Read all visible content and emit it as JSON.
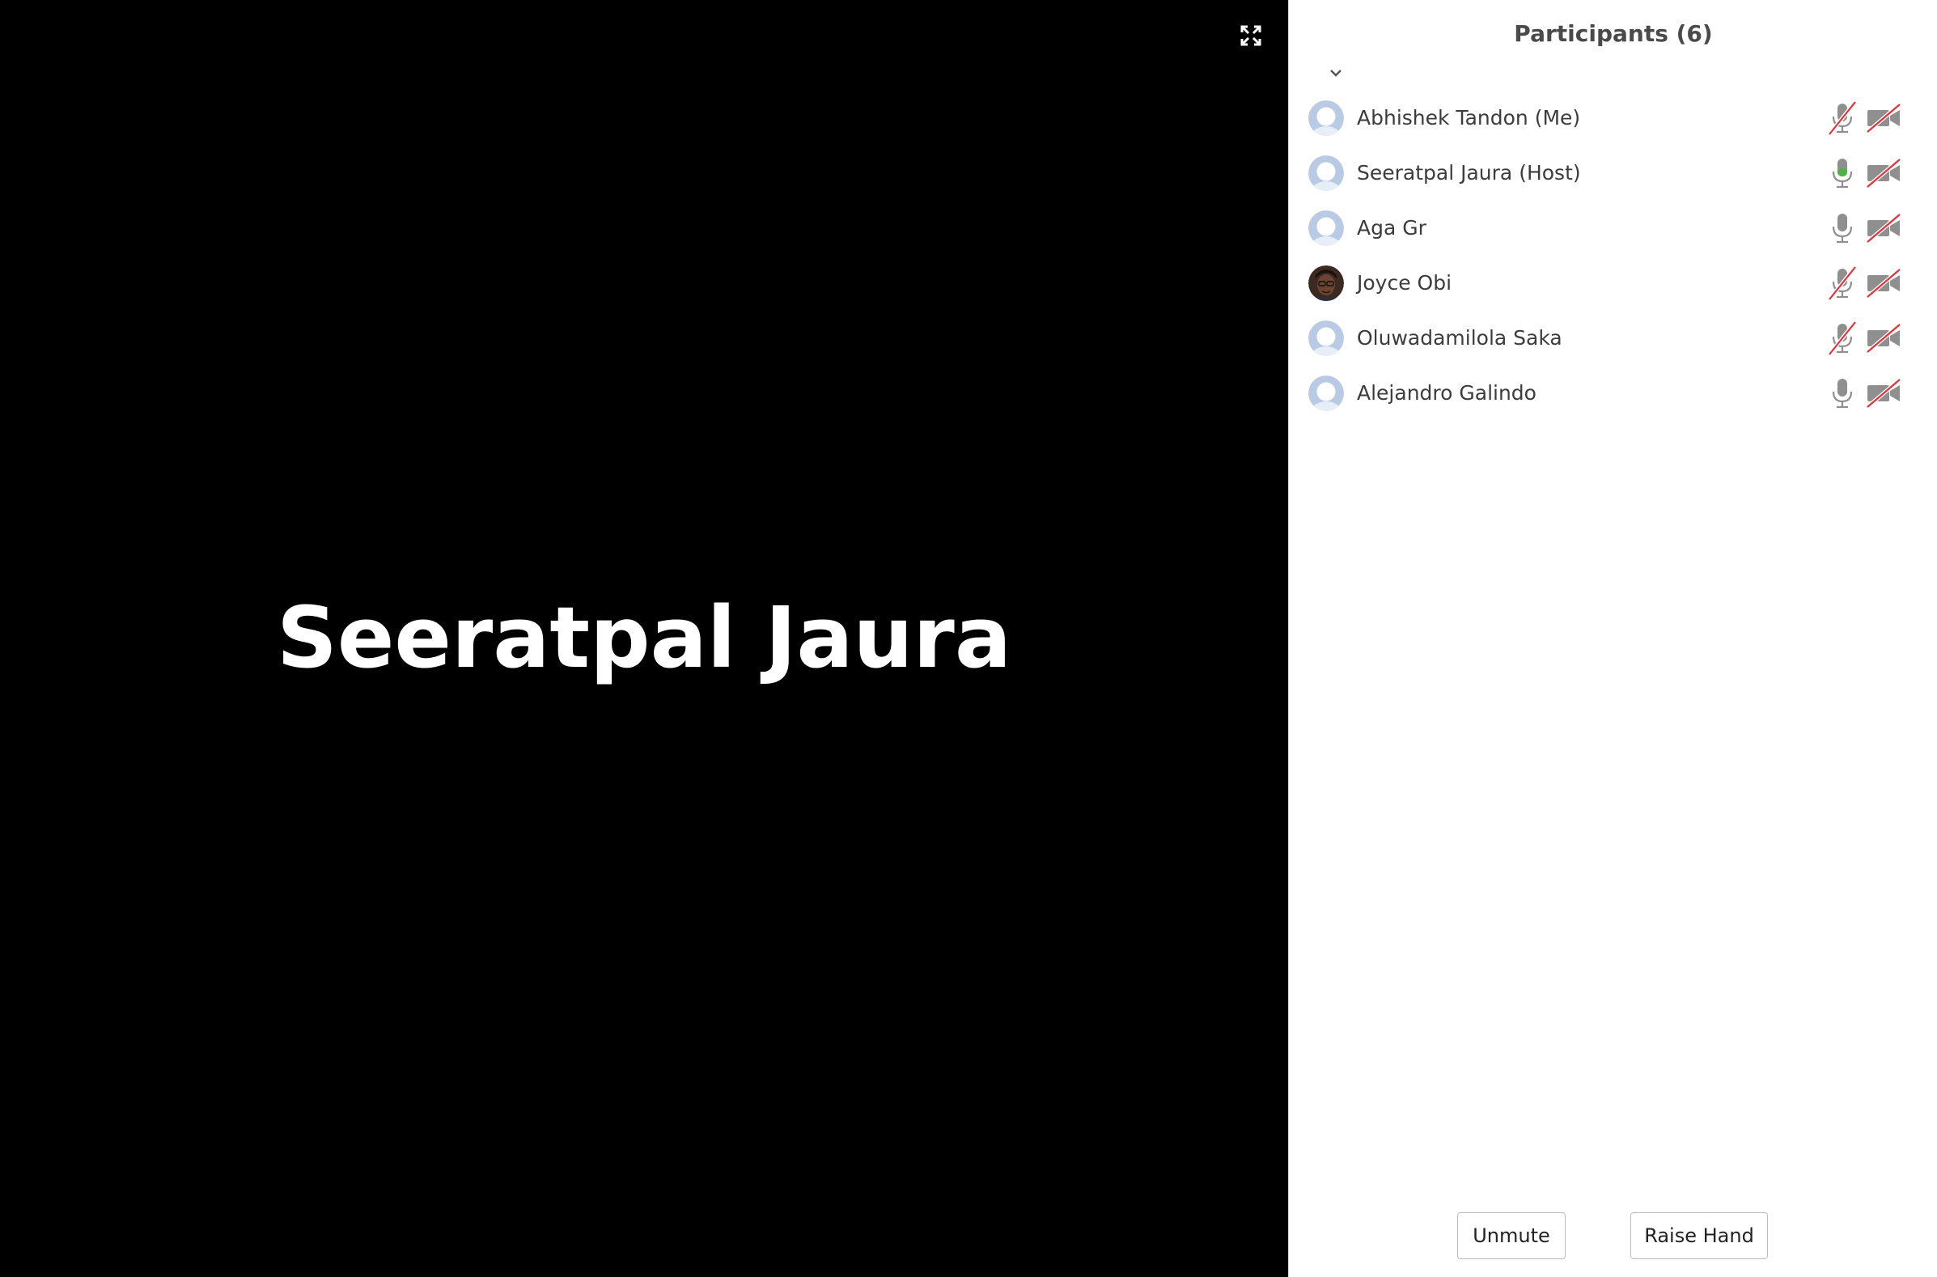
{
  "stage": {
    "active_speaker": "Seeratpal Jaura",
    "fullscreen_icon": "expand-icon"
  },
  "panel": {
    "title": "Participants (6)",
    "collapse_icon": "chevron-down-icon",
    "participants": [
      {
        "name": "Abhishek Tandon (Me)",
        "avatar": "default-avatar",
        "mic": "muted",
        "video": "off"
      },
      {
        "name": "Seeratpal Jaura (Host)",
        "avatar": "default-avatar",
        "mic": "speaking",
        "video": "off"
      },
      {
        "name": "Aga Gr",
        "avatar": "default-avatar",
        "mic": "on",
        "video": "off"
      },
      {
        "name": "Joyce Obi",
        "avatar": "photo",
        "mic": "muted",
        "video": "off"
      },
      {
        "name": "Oluwadamilola Saka",
        "avatar": "default-avatar",
        "mic": "muted",
        "video": "off"
      },
      {
        "name": "Alejandro Galindo",
        "avatar": "default-avatar",
        "mic": "on",
        "video": "off"
      }
    ],
    "buttons": {
      "unmute": "Unmute",
      "raise_hand": "Raise Hand"
    }
  },
  "colors": {
    "stage_bg": "#000000",
    "panel_bg": "#ffffff",
    "muted_slash": "#e0323b",
    "speaking_green": "#52b04a",
    "icon_gray": "#8f8f8f",
    "avatar_blue": "#b9cbe4"
  }
}
